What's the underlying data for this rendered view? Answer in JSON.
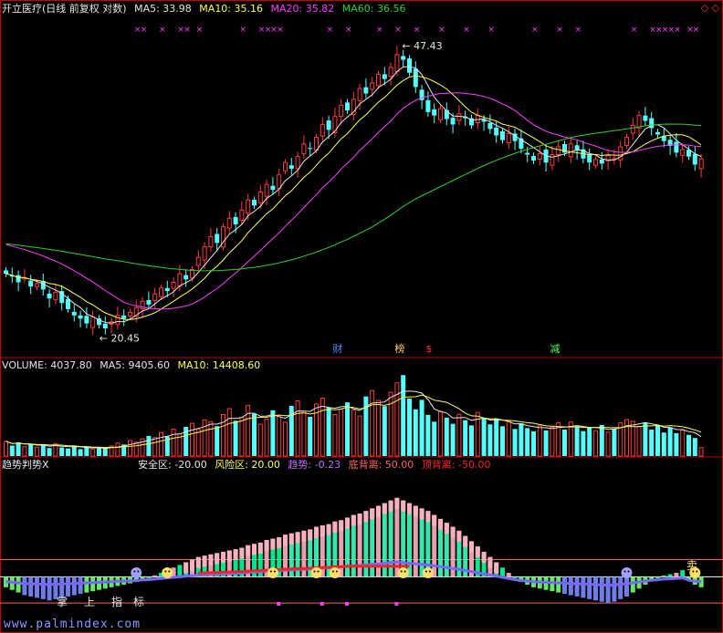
{
  "colors": {
    "up": "#ff3a3a",
    "down": "#54ffff",
    "ma5": "#e6e6e6",
    "ma10": "#ffff4d",
    "ma20": "#ff3cff",
    "ma60": "#2fd02f",
    "frame": "#c00000",
    "ind_main": "#00ff9c",
    "ind_pink": "#ffb0c0",
    "ind_trend": "#7a66ff",
    "ind_red": "#ff2020"
  },
  "header": {
    "title": "开立医疗(日线 前复权 对数)",
    "ma5": "MA5: 33.98",
    "ma10": "MA10: 35.16",
    "ma20": "MA20: 35.82",
    "ma60": "MA60: 36.56",
    "corner": "◇ ◇"
  },
  "price_labels": {
    "high": "47.43",
    "low": "20.45"
  },
  "events": [
    "财",
    "榜",
    "$",
    "减"
  ],
  "volume_header": {
    "title": "VOLUME: 4037.80",
    "ma5": "MA5: 9405.60",
    "ma10": "MA10: 14408.60"
  },
  "indicator_header": {
    "title": "趋势判势X",
    "safe": "安全区: -20.00",
    "risk": "风险区: 20.00",
    "trend": "趋势: -0.23",
    "bottom_div": "底背离: 50.00",
    "top_div": "顶背离: -50.00"
  },
  "indicator_marks": [
    "掌",
    "上",
    "指",
    "标",
    "卖"
  ],
  "watermark": "www.palmindex.com",
  "chart_data": [
    {
      "type": "candlestick",
      "title": "开立医疗(日线 前复权 对数)",
      "scale": "log",
      "ylim": [
        19,
        52
      ],
      "extremes": {
        "high": 47.43,
        "low": 20.45
      },
      "close": [
        24.2,
        24.0,
        23.6,
        23.9,
        23.3,
        23.5,
        23.1,
        22.5,
        22.9,
        22.2,
        21.8,
        21.4,
        21.2,
        20.9,
        21.3,
        20.8,
        20.6,
        21.0,
        21.4,
        21.2,
        21.6,
        21.9,
        22.3,
        22.1,
        22.8,
        23.2,
        23.0,
        23.6,
        24.2,
        23.8,
        24.5,
        25.4,
        26.2,
        27.0,
        26.5,
        27.8,
        28.5,
        28.0,
        29.2,
        30.1,
        29.6,
        30.8,
        31.5,
        31.0,
        32.4,
        33.6,
        33.0,
        34.2,
        35.5,
        35.0,
        36.2,
        37.6,
        37.0,
        38.5,
        39.8,
        39.2,
        40.5,
        41.8,
        41.2,
        42.5,
        43.6,
        43.0,
        44.5,
        46.2,
        45.5,
        43.8,
        42.0,
        40.4,
        39.0,
        38.6,
        39.4,
        38.2,
        37.6,
        38.8,
        38.3,
        37.5,
        38.6,
        37.9,
        37.1,
        36.4,
        35.9,
        36.6,
        35.8,
        35.0,
        34.4,
        33.8,
        34.5,
        33.6,
        34.4,
        35.2,
        34.6,
        35.5,
        34.8,
        34.0,
        33.6,
        33.9,
        33.5,
        34.3,
        34.0,
        35.2,
        36.2,
        37.5,
        38.6,
        38.0,
        37.2,
        36.5,
        35.8,
        35.3,
        34.6,
        34.9,
        34.2,
        33.4,
        33.98
      ],
      "ma_current": {
        "MA5": 33.98,
        "MA10": 35.16,
        "MA20": 35.82,
        "MA60": 36.56
      }
    },
    {
      "type": "bar",
      "title": "VOLUME",
      "current": 4037.8,
      "ma5": 9405.6,
      "ma10": 14408.6,
      "ylim": [
        0,
        40000
      ],
      "values": [
        7000,
        5000,
        6500,
        4500,
        5800,
        4200,
        5200,
        3800,
        6000,
        4100,
        3600,
        4900,
        3300,
        4400,
        3200,
        3900,
        3500,
        4800,
        6200,
        5500,
        7400,
        6600,
        8200,
        9600,
        8800,
        11200,
        9300,
        12800,
        10600,
        13900,
        15600,
        12900,
        17200,
        16400,
        14200,
        19800,
        22600,
        16800,
        18400,
        24200,
        20100,
        15200,
        17600,
        21800,
        19300,
        16100,
        23900,
        26300,
        21400,
        18700,
        24800,
        27600,
        23100,
        19800,
        22400,
        25600,
        21900,
        19100,
        28400,
        31200,
        26500,
        23800,
        30400,
        34900,
        38600,
        27400,
        22300,
        26800,
        19600,
        16400,
        21200,
        18300,
        15400,
        19900,
        17100,
        14600,
        20800,
        18200,
        15100,
        17800,
        14200,
        16700,
        12900,
        15600,
        13300,
        11800,
        14400,
        12200,
        13800,
        15900,
        12600,
        16200,
        14100,
        11900,
        13500,
        12100,
        14800,
        11400,
        12800,
        15800,
        17400,
        16600,
        14100,
        15900,
        12600,
        14900,
        11200,
        13700,
        10900,
        12400,
        10100,
        8600,
        4037.8
      ]
    },
    {
      "type": "bar",
      "title": "趋势判势X",
      "thresholds": {
        "安全区": -20,
        "风险区": 20,
        "底背离": 50,
        "顶背离": -50
      },
      "trend_current": -0.23,
      "ylim": [
        -40,
        80
      ],
      "values": [
        -8,
        -10,
        -12,
        -14,
        -15,
        -16,
        -17,
        -18,
        -17,
        -16,
        -15,
        -14,
        -13,
        -12,
        -11,
        -10,
        -9,
        -8,
        -7,
        -6,
        -5,
        -4,
        -2,
        -1,
        1,
        3,
        5,
        7,
        9,
        11,
        13,
        15,
        16,
        17,
        18,
        19,
        20,
        21,
        22,
        24,
        25,
        26,
        28,
        29,
        30,
        32,
        33,
        34,
        35,
        36,
        38,
        39,
        40,
        42,
        43,
        45,
        47,
        48,
        50,
        52,
        54,
        56,
        58,
        60,
        58,
        56,
        54,
        52,
        50,
        47,
        44,
        41,
        38,
        35,
        31,
        27,
        23,
        19,
        15,
        11,
        7,
        3,
        -1,
        -4,
        -6,
        -8,
        -9,
        -10,
        -11,
        -12,
        -13,
        -14,
        -15,
        -16,
        -17,
        -18,
        -19,
        -20,
        -19,
        -17,
        -15,
        -12,
        -9,
        -6,
        -3,
        -1,
        1,
        2,
        3,
        5,
        -3,
        -6,
        -8
      ]
    }
  ]
}
